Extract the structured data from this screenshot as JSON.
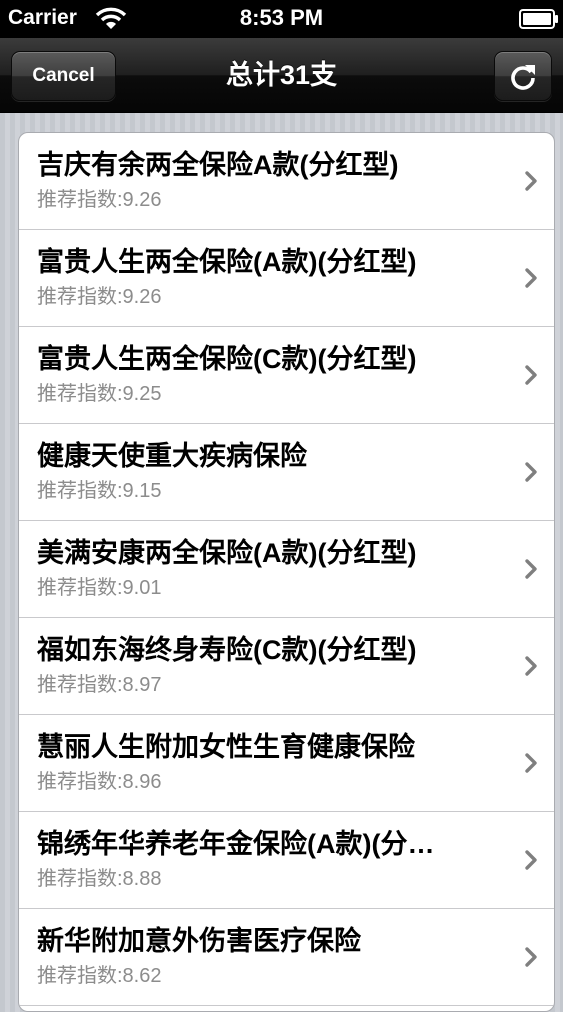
{
  "status_bar": {
    "carrier": "Carrier",
    "time": "8:53 PM",
    "icons": [
      "wifi-icon",
      "battery-icon"
    ]
  },
  "nav_bar": {
    "cancel_label": "Cancel",
    "title": "总计31支",
    "refresh_icon": "refresh-icon"
  },
  "list": {
    "items": [
      {
        "title": "吉庆有余两全保险A款(分红型)",
        "subtitle": "推荐指数:9.26"
      },
      {
        "title": "富贵人生两全保险(A款)(分红型)",
        "subtitle": "推荐指数:9.26"
      },
      {
        "title": "富贵人生两全保险(C款)(分红型)",
        "subtitle": "推荐指数:9.25"
      },
      {
        "title": "健康天使重大疾病保险",
        "subtitle": "推荐指数:9.15"
      },
      {
        "title": "美满安康两全保险(A款)(分红型)",
        "subtitle": "推荐指数:9.01"
      },
      {
        "title": "福如东海终身寿险(C款)(分红型)",
        "subtitle": "推荐指数:8.97"
      },
      {
        "title": "慧丽人生附加女性生育健康保险",
        "subtitle": "推荐指数:8.96"
      },
      {
        "title": "锦绣年华养老年金保险(A款)(分…",
        "subtitle": "推荐指数:8.88"
      },
      {
        "title": "新华附加意外伤害医疗保险",
        "subtitle": "推荐指数:8.62"
      }
    ]
  },
  "colors": {
    "nav_background": "#1f1f1f",
    "list_background": "#ffffff",
    "subtitle_text": "#8c8c8c",
    "chevron": "#7f7f7f"
  }
}
